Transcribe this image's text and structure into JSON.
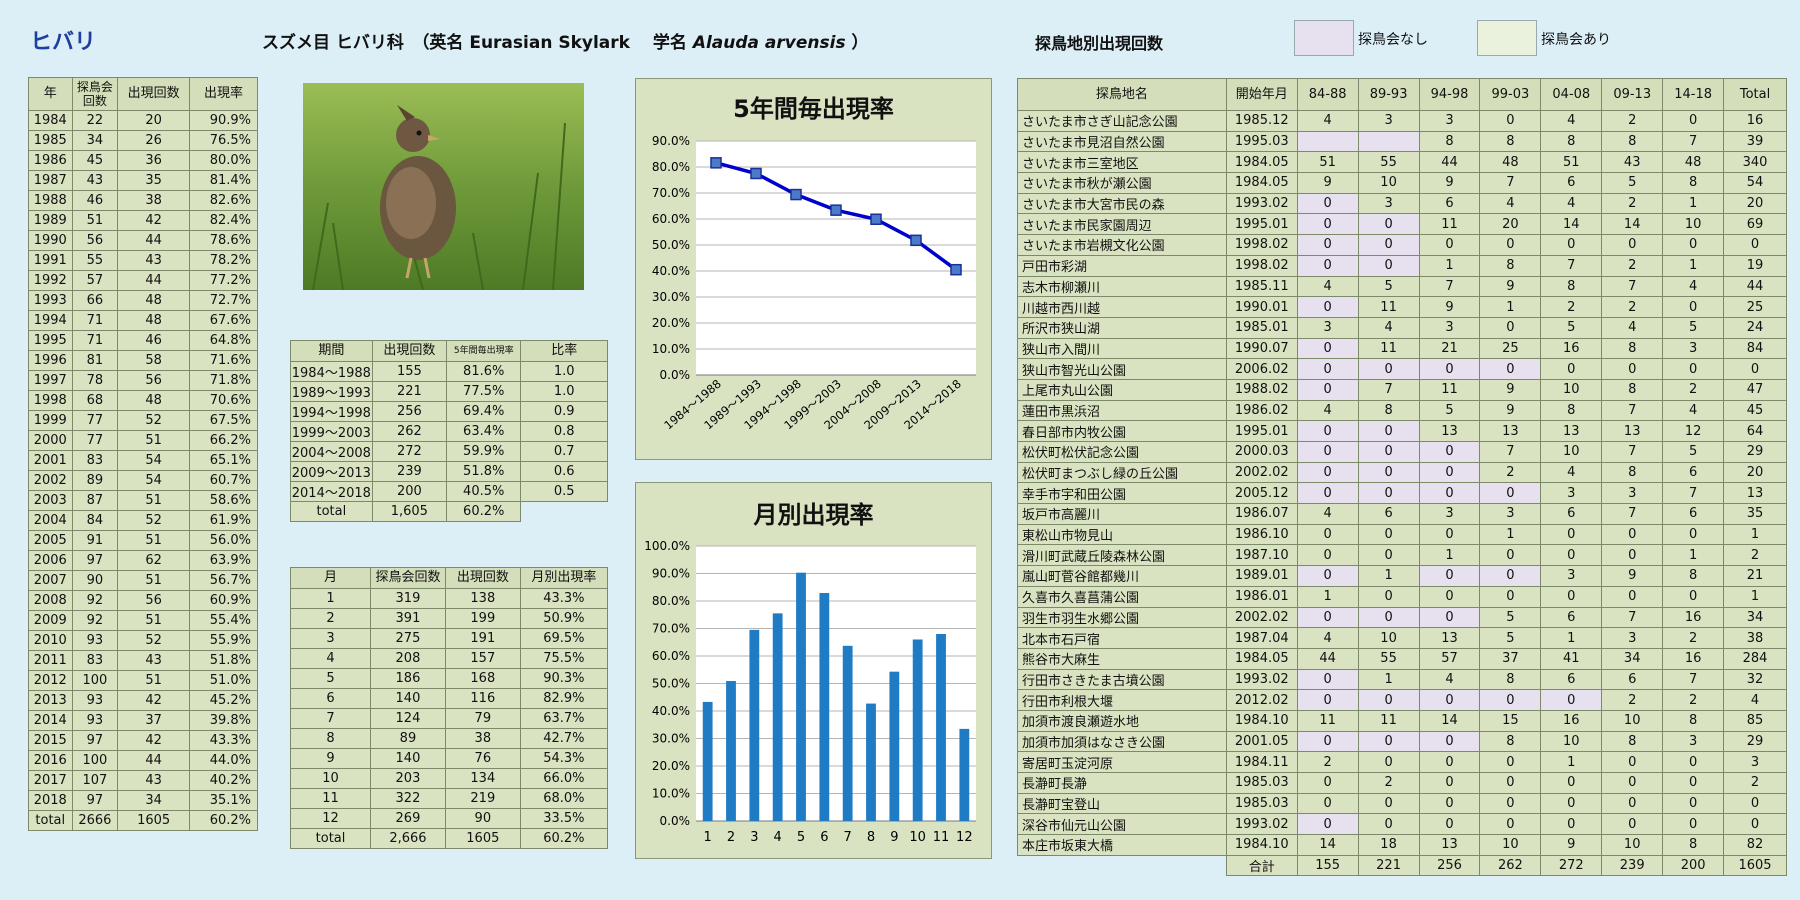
{
  "header": {
    "species": "ヒバリ",
    "info_prefix": "スズメ目 ヒバリ科　（英名 Eurasian Skylark　 学名 ",
    "info_latin": "Alauda arvensis",
    "info_suffix": " ）",
    "sites_title": "探鳥地別出現回数",
    "legend": [
      {
        "label": "探鳥会なし",
        "color": "#e6e0ef"
      },
      {
        "label": "探鳥会あり",
        "color": "#eaf1dd"
      }
    ]
  },
  "yearly_table": {
    "headers": [
      "年",
      "探鳥会回数",
      "出現回数",
      "出現率"
    ],
    "rows": [
      [
        "1984",
        "22",
        "20",
        "90.9%"
      ],
      [
        "1985",
        "34",
        "26",
        "76.5%"
      ],
      [
        "1986",
        "45",
        "36",
        "80.0%"
      ],
      [
        "1987",
        "43",
        "35",
        "81.4%"
      ],
      [
        "1988",
        "46",
        "38",
        "82.6%"
      ],
      [
        "1989",
        "51",
        "42",
        "82.4%"
      ],
      [
        "1990",
        "56",
        "44",
        "78.6%"
      ],
      [
        "1991",
        "55",
        "43",
        "78.2%"
      ],
      [
        "1992",
        "57",
        "44",
        "77.2%"
      ],
      [
        "1993",
        "66",
        "48",
        "72.7%"
      ],
      [
        "1994",
        "71",
        "48",
        "67.6%"
      ],
      [
        "1995",
        "71",
        "46",
        "64.8%"
      ],
      [
        "1996",
        "81",
        "58",
        "71.6%"
      ],
      [
        "1997",
        "78",
        "56",
        "71.8%"
      ],
      [
        "1998",
        "68",
        "48",
        "70.6%"
      ],
      [
        "1999",
        "77",
        "52",
        "67.5%"
      ],
      [
        "2000",
        "77",
        "51",
        "66.2%"
      ],
      [
        "2001",
        "83",
        "54",
        "65.1%"
      ],
      [
        "2002",
        "89",
        "54",
        "60.7%"
      ],
      [
        "2003",
        "87",
        "51",
        "58.6%"
      ],
      [
        "2004",
        "84",
        "52",
        "61.9%"
      ],
      [
        "2005",
        "91",
        "51",
        "56.0%"
      ],
      [
        "2006",
        "97",
        "62",
        "63.9%"
      ],
      [
        "2007",
        "90",
        "51",
        "56.7%"
      ],
      [
        "2008",
        "92",
        "56",
        "60.9%"
      ],
      [
        "2009",
        "92",
        "51",
        "55.4%"
      ],
      [
        "2010",
        "93",
        "52",
        "55.9%"
      ],
      [
        "2011",
        "83",
        "43",
        "51.8%"
      ],
      [
        "2012",
        "100",
        "51",
        "51.0%"
      ],
      [
        "2013",
        "93",
        "42",
        "45.2%"
      ],
      [
        "2014",
        "93",
        "37",
        "39.8%"
      ],
      [
        "2015",
        "97",
        "42",
        "43.3%"
      ],
      [
        "2016",
        "100",
        "44",
        "44.0%"
      ],
      [
        "2017",
        "107",
        "43",
        "40.2%"
      ],
      [
        "2018",
        "97",
        "34",
        "35.1%"
      ],
      [
        "total",
        "2666",
        "1605",
        "60.2%"
      ]
    ]
  },
  "period_table": {
    "headers": [
      "期間",
      "出現回数",
      "5年間毎出現率",
      "比率"
    ],
    "rows": [
      [
        "1984～1988",
        "155",
        "81.6%",
        "1.0"
      ],
      [
        "1989～1993",
        "221",
        "77.5%",
        "1.0"
      ],
      [
        "1994～1998",
        "256",
        "69.4%",
        "0.9"
      ],
      [
        "1999～2003",
        "262",
        "63.4%",
        "0.8"
      ],
      [
        "2004～2008",
        "272",
        "59.9%",
        "0.7"
      ],
      [
        "2009～2013",
        "239",
        "51.8%",
        "0.6"
      ],
      [
        "2014～2018",
        "200",
        "40.5%",
        "0.5"
      ]
    ],
    "total": [
      "total",
      "1,605",
      "60.2%"
    ]
  },
  "month_table": {
    "headers": [
      "月",
      "探鳥会回数",
      "出現回数",
      "月別出現率"
    ],
    "rows": [
      [
        "1",
        "319",
        "138",
        "43.3%"
      ],
      [
        "2",
        "391",
        "199",
        "50.9%"
      ],
      [
        "3",
        "275",
        "191",
        "69.5%"
      ],
      [
        "4",
        "208",
        "157",
        "75.5%"
      ],
      [
        "5",
        "186",
        "168",
        "90.3%"
      ],
      [
        "6",
        "140",
        "116",
        "82.9%"
      ],
      [
        "7",
        "124",
        "79",
        "63.7%"
      ],
      [
        "8",
        "89",
        "38",
        "42.7%"
      ],
      [
        "9",
        "140",
        "76",
        "54.3%"
      ],
      [
        "10",
        "203",
        "134",
        "66.0%"
      ],
      [
        "11",
        "322",
        "219",
        "68.0%"
      ],
      [
        "12",
        "269",
        "90",
        "33.5%"
      ],
      [
        "total",
        "2,666",
        "1605",
        "60.2%"
      ]
    ]
  },
  "sites_table": {
    "headers": [
      "探鳥地名",
      "開始年月",
      "84-88",
      "89-93",
      "94-98",
      "99-03",
      "04-08",
      "09-13",
      "14-18",
      "Total"
    ],
    "rows": [
      {
        "name": "さいたま市さぎ山記念公園",
        "start": "1985.12",
        "v": [
          "4",
          "3",
          "3",
          "0",
          "4",
          "2",
          "0",
          "16"
        ],
        "empty": []
      },
      {
        "name": "さいたま市見沼自然公園",
        "start": "1995.03",
        "v": [
          "",
          "",
          "8",
          "8",
          "8",
          "8",
          "7",
          "39"
        ],
        "empty": [
          0,
          1
        ]
      },
      {
        "name": "さいたま市三室地区",
        "start": "1984.05",
        "v": [
          "51",
          "55",
          "44",
          "48",
          "51",
          "43",
          "48",
          "340"
        ],
        "empty": []
      },
      {
        "name": "さいたま市秋が瀬公園",
        "start": "1984.05",
        "v": [
          "9",
          "10",
          "9",
          "7",
          "6",
          "5",
          "8",
          "54"
        ],
        "empty": []
      },
      {
        "name": "さいたま市大宮市民の森",
        "start": "1993.02",
        "v": [
          "0",
          "3",
          "6",
          "4",
          "4",
          "2",
          "1",
          "20"
        ],
        "empty": [
          0
        ]
      },
      {
        "name": "さいたま市民家園周辺",
        "start": "1995.01",
        "v": [
          "0",
          "0",
          "11",
          "20",
          "14",
          "14",
          "10",
          "69"
        ],
        "empty": [
          0,
          1
        ]
      },
      {
        "name": "さいたま市岩槻文化公園",
        "start": "1998.02",
        "v": [
          "0",
          "0",
          "0",
          "0",
          "0",
          "0",
          "0",
          "0"
        ],
        "empty": [
          0,
          1
        ]
      },
      {
        "name": "戸田市彩湖",
        "start": "1998.02",
        "v": [
          "0",
          "0",
          "1",
          "8",
          "7",
          "2",
          "1",
          "19"
        ],
        "empty": [
          0,
          1
        ]
      },
      {
        "name": "志木市柳瀬川",
        "start": "1985.11",
        "v": [
          "4",
          "5",
          "7",
          "9",
          "8",
          "7",
          "4",
          "44"
        ],
        "empty": []
      },
      {
        "name": "川越市西川越",
        "start": "1990.01",
        "v": [
          "0",
          "11",
          "9",
          "1",
          "2",
          "2",
          "0",
          "25"
        ],
        "empty": [
          0
        ]
      },
      {
        "name": "所沢市狭山湖",
        "start": "1985.01",
        "v": [
          "3",
          "4",
          "3",
          "0",
          "5",
          "4",
          "5",
          "24"
        ],
        "empty": []
      },
      {
        "name": "狭山市入間川",
        "start": "1990.07",
        "v": [
          "0",
          "11",
          "21",
          "25",
          "16",
          "8",
          "3",
          "84"
        ],
        "empty": [
          0
        ]
      },
      {
        "name": "狭山市智光山公園",
        "start": "2006.02",
        "v": [
          "0",
          "0",
          "0",
          "0",
          "0",
          "0",
          "0",
          "0"
        ],
        "empty": [
          0,
          1,
          2,
          3
        ]
      },
      {
        "name": "上尾市丸山公園",
        "start": "1988.02",
        "v": [
          "0",
          "7",
          "11",
          "9",
          "10",
          "8",
          "2",
          "47"
        ],
        "empty": [
          0
        ]
      },
      {
        "name": "蓮田市黒浜沼",
        "start": "1986.02",
        "v": [
          "4",
          "8",
          "5",
          "9",
          "8",
          "7",
          "4",
          "45"
        ],
        "empty": []
      },
      {
        "name": "春日部市内牧公園",
        "start": "1995.01",
        "v": [
          "0",
          "0",
          "13",
          "13",
          "13",
          "13",
          "12",
          "64"
        ],
        "empty": [
          0,
          1
        ]
      },
      {
        "name": "松伏町松伏記念公園",
        "start": "2000.03",
        "v": [
          "0",
          "0",
          "0",
          "7",
          "10",
          "7",
          "5",
          "29"
        ],
        "empty": [
          0,
          1,
          2
        ]
      },
      {
        "name": "松伏町まつぶし緑の丘公園",
        "start": "2002.02",
        "v": [
          "0",
          "0",
          "0",
          "2",
          "4",
          "8",
          "6",
          "20"
        ],
        "empty": [
          0,
          1,
          2
        ]
      },
      {
        "name": "幸手市宇和田公園",
        "start": "2005.12",
        "v": [
          "0",
          "0",
          "0",
          "0",
          "3",
          "3",
          "7",
          "13"
        ],
        "empty": [
          0,
          1,
          2,
          3
        ]
      },
      {
        "name": "坂戸市高麗川",
        "start": "1986.07",
        "v": [
          "4",
          "6",
          "3",
          "3",
          "6",
          "7",
          "6",
          "35"
        ],
        "empty": []
      },
      {
        "name": "東松山市物見山",
        "start": "1986.10",
        "v": [
          "0",
          "0",
          "0",
          "1",
          "0",
          "0",
          "0",
          "1"
        ],
        "empty": []
      },
      {
        "name": "滑川町武蔵丘陵森林公園",
        "start": "1987.10",
        "v": [
          "0",
          "0",
          "1",
          "0",
          "0",
          "0",
          "1",
          "2"
        ],
        "empty": []
      },
      {
        "name": "嵐山町菅谷館都幾川",
        "start": "1989.01",
        "v": [
          "0",
          "1",
          "0",
          "0",
          "3",
          "9",
          "8",
          "21"
        ],
        "empty": [
          0,
          2,
          3
        ]
      },
      {
        "name": "久喜市久喜菖蒲公園",
        "start": "1986.01",
        "v": [
          "1",
          "0",
          "0",
          "0",
          "0",
          "0",
          "0",
          "1"
        ],
        "empty": []
      },
      {
        "name": "羽生市羽生水郷公園",
        "start": "2002.02",
        "v": [
          "0",
          "0",
          "0",
          "5",
          "6",
          "7",
          "16",
          "34"
        ],
        "empty": [
          0,
          1,
          2
        ]
      },
      {
        "name": "北本市石戸宿",
        "start": "1987.04",
        "v": [
          "4",
          "10",
          "13",
          "5",
          "1",
          "3",
          "2",
          "38"
        ],
        "empty": []
      },
      {
        "name": "熊谷市大麻生",
        "start": "1984.05",
        "v": [
          "44",
          "55",
          "57",
          "37",
          "41",
          "34",
          "16",
          "284"
        ],
        "empty": []
      },
      {
        "name": "行田市さきたま古墳公園",
        "start": "1993.02",
        "v": [
          "0",
          "1",
          "4",
          "8",
          "6",
          "6",
          "7",
          "32"
        ],
        "empty": [
          0
        ]
      },
      {
        "name": "行田市利根大堰",
        "start": "2012.02",
        "v": [
          "0",
          "0",
          "0",
          "0",
          "0",
          "2",
          "2",
          "4"
        ],
        "empty": [
          0,
          1,
          2,
          3,
          4
        ]
      },
      {
        "name": "加須市渡良瀬遊水地",
        "start": "1984.10",
        "v": [
          "11",
          "11",
          "14",
          "15",
          "16",
          "10",
          "8",
          "85"
        ],
        "empty": []
      },
      {
        "name": "加須市加須はなさき公園",
        "start": "2001.05",
        "v": [
          "0",
          "0",
          "0",
          "8",
          "10",
          "8",
          "3",
          "29"
        ],
        "empty": [
          0,
          1,
          2
        ]
      },
      {
        "name": "寄居町玉淀河原",
        "start": "1984.11",
        "v": [
          "2",
          "0",
          "0",
          "0",
          "1",
          "0",
          "0",
          "3"
        ],
        "empty": []
      },
      {
        "name": "長瀞町長瀞",
        "start": "1985.03",
        "v": [
          "0",
          "2",
          "0",
          "0",
          "0",
          "0",
          "0",
          "2"
        ],
        "empty": []
      },
      {
        "name": "長瀞町宝登山",
        "start": "1985.03",
        "v": [
          "0",
          "0",
          "0",
          "0",
          "0",
          "0",
          "0",
          "0"
        ],
        "empty": []
      },
      {
        "name": "深谷市仙元山公園",
        "start": "1993.02",
        "v": [
          "0",
          "0",
          "0",
          "0",
          "0",
          "0",
          "0",
          "0"
        ],
        "empty": [
          0
        ]
      },
      {
        "name": "本庄市坂東大橋",
        "start": "1984.10",
        "v": [
          "14",
          "18",
          "13",
          "10",
          "9",
          "10",
          "8",
          "82"
        ],
        "empty": []
      }
    ],
    "total_label": "合計",
    "totals": [
      "155",
      "221",
      "256",
      "262",
      "272",
      "239",
      "200",
      "1605"
    ]
  },
  "chart_data": [
    {
      "type": "line",
      "title": "5年間毎出現率",
      "categories": [
        "1984～1988",
        "1989～1993",
        "1994～1998",
        "1999～2003",
        "2004～2008",
        "2009～2013",
        "2014～2018"
      ],
      "values": [
        81.6,
        77.5,
        69.4,
        63.4,
        59.9,
        51.8,
        40.5
      ],
      "ylim": [
        0,
        90
      ],
      "yticks": [
        "0.0%",
        "10.0%",
        "20.0%",
        "30.0%",
        "40.0%",
        "50.0%",
        "60.0%",
        "70.0%",
        "80.0%",
        "90.0%"
      ],
      "color": "#0000cc",
      "grid": true
    },
    {
      "type": "bar",
      "title": "月別出現率",
      "categories": [
        "1",
        "2",
        "3",
        "4",
        "5",
        "6",
        "7",
        "8",
        "9",
        "10",
        "11",
        "12"
      ],
      "values": [
        43.3,
        50.9,
        69.5,
        75.5,
        90.3,
        82.9,
        63.7,
        42.7,
        54.3,
        66.0,
        68.0,
        33.5
      ],
      "ylim": [
        0,
        100
      ],
      "yticks": [
        "0.0%",
        "10.0%",
        "20.0%",
        "30.0%",
        "40.0%",
        "50.0%",
        "60.0%",
        "70.0%",
        "80.0%",
        "90.0%",
        "100.0%"
      ],
      "color": "#1f7bc4",
      "grid": true
    }
  ],
  "photo": {
    "alt": "ヒバリ",
    "grass": "#6f9a3a",
    "bird": "#6b5640"
  }
}
